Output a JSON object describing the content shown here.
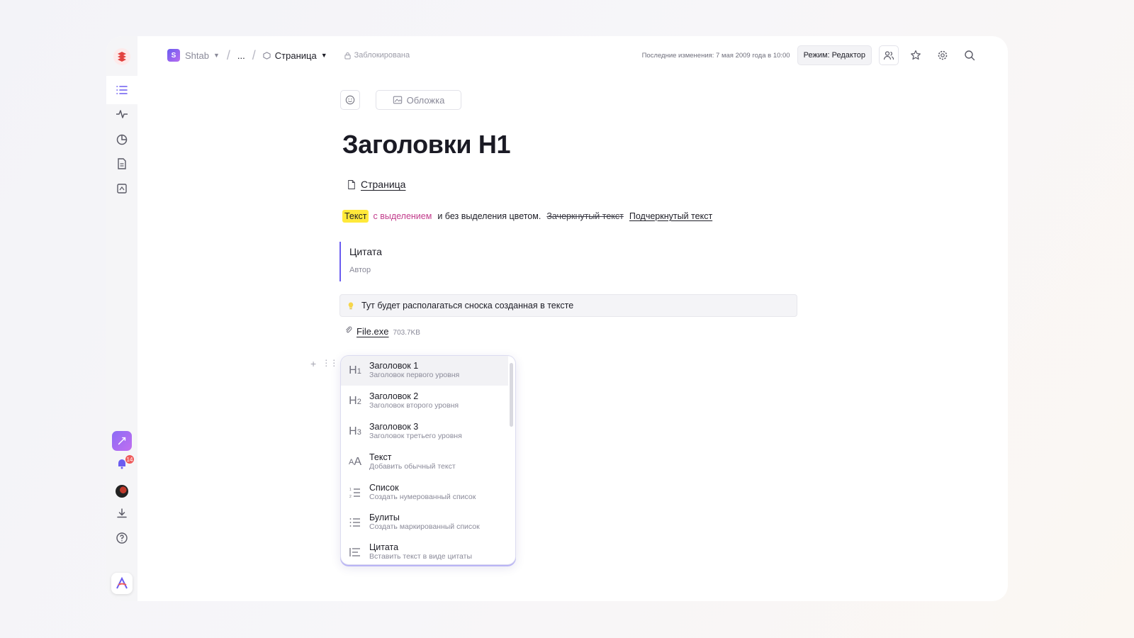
{
  "breadcrumb": {
    "workspace_badge": "S",
    "workspace": "Shtab",
    "ellipsis": "...",
    "current_page": "Страница",
    "lock_status": "Заблокирована"
  },
  "header": {
    "last_changes": "Последние изменения: 7 мая 2009 года в 10:00",
    "mode_button": "Режим: Редактор"
  },
  "sidebar": {
    "notification_count": "14",
    "icons": [
      "logo-icon",
      "list-icon",
      "activity-icon",
      "chart-icon",
      "document-icon",
      "image-icon",
      "rocket-icon",
      "bell-icon",
      "avatar",
      "download-icon",
      "help-icon",
      "app-logo-icon"
    ]
  },
  "document": {
    "cover_button": "Обложка",
    "title": "Заголовки H1",
    "page_link": "Страница",
    "rich_text": {
      "highlight": "Текст",
      "colored": "с выделением",
      "plain": "и без выделения цветом.",
      "strikethrough": "Зачеркнутый текст",
      "underlined": "Подчеркнутый текст"
    },
    "quote": {
      "text": "Цитата",
      "author": "Автор"
    },
    "callout": "Тут будет располагаться сноска созданная в тексте",
    "file": {
      "name": "File.exe",
      "size": "703.7KB"
    }
  },
  "block_menu": {
    "items": [
      {
        "icon": "H1",
        "title": "Заголовок 1",
        "description": "Заголовок первого уровня"
      },
      {
        "icon": "H2",
        "title": "Заголовок 2",
        "description": "Заголовок второго уровня"
      },
      {
        "icon": "H3",
        "title": "Заголовок 3",
        "description": "Заголовок третьего уровня"
      },
      {
        "icon": "text-size-icon",
        "title": "Текст",
        "description": "Добавить обычный текст"
      },
      {
        "icon": "numbered-list-icon",
        "title": "Список",
        "description": "Создать нумерованный список"
      },
      {
        "icon": "bullet-list-icon",
        "title": "Булиты",
        "description": "Создать маркированный список"
      },
      {
        "icon": "quote-icon",
        "title": "Цитата",
        "description": "Вставить текст в виде цитаты"
      }
    ]
  },
  "colors": {
    "accent": "#6b5cf0",
    "highlight": "#ffe93a",
    "pink_text": "#c23c8c",
    "badge_red": "#ef5a5a"
  }
}
